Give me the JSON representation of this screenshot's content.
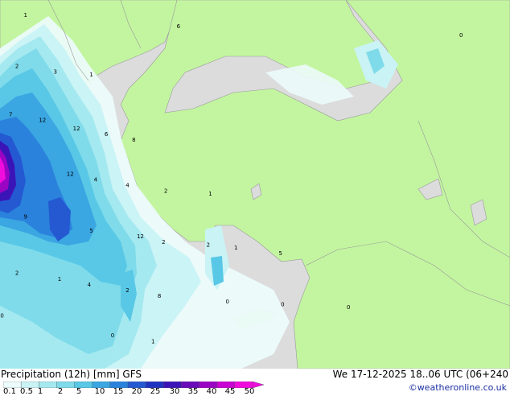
{
  "footer": {
    "title": "Precipitation (12h) [mm] GFS",
    "datetime": "We 17-12-2025 18..06 UTC (06+240",
    "credit": "©weatheronline.co.uk"
  },
  "legend": {
    "labels": [
      "0.1",
      "0.5",
      "1",
      "2",
      "5",
      "10",
      "15",
      "20",
      "25",
      "30",
      "35",
      "40",
      "45",
      "50"
    ],
    "colors": [
      "#ecfbfb",
      "#c9f3f5",
      "#a5e9f0",
      "#7fdbea",
      "#58c8e6",
      "#3aa6e2",
      "#2b82dc",
      "#2459d2",
      "#1f33c1",
      "#3b14b8",
      "#6a0cba",
      "#9a05c4",
      "#c805d2",
      "#f00cdc"
    ]
  },
  "map_labels": [
    {
      "text": "1",
      "lon": 19.2,
      "lat": 41.9
    },
    {
      "text": "6",
      "lon": 26.4,
      "lat": 41.5
    },
    {
      "text": "2",
      "lon": 18.8,
      "lat": 40.1
    },
    {
      "text": "3",
      "lon": 20.6,
      "lat": 39.9
    },
    {
      "text": "1",
      "lon": 22.3,
      "lat": 39.8
    },
    {
      "text": "7",
      "lon": 18.5,
      "lat": 38.4
    },
    {
      "text": "12",
      "lon": 20.0,
      "lat": 38.2
    },
    {
      "text": "12",
      "lon": 21.6,
      "lat": 37.9
    },
    {
      "text": "6",
      "lon": 23.0,
      "lat": 37.7
    },
    {
      "text": "8",
      "lon": 24.3,
      "lat": 37.5
    },
    {
      "text": "12",
      "lon": 21.3,
      "lat": 36.3
    },
    {
      "text": "4",
      "lon": 22.5,
      "lat": 36.1
    },
    {
      "text": "4",
      "lon": 24.0,
      "lat": 35.9
    },
    {
      "text": "2",
      "lon": 25.8,
      "lat": 35.7
    },
    {
      "text": "1",
      "lon": 27.9,
      "lat": 35.6
    },
    {
      "text": "9",
      "lon": 19.2,
      "lat": 34.8
    },
    {
      "text": "5",
      "lon": 22.3,
      "lat": 34.3
    },
    {
      "text": "12",
      "lon": 24.6,
      "lat": 34.1
    },
    {
      "text": "2",
      "lon": 25.7,
      "lat": 33.9
    },
    {
      "text": "2",
      "lon": 27.8,
      "lat": 33.8
    },
    {
      "text": "1",
      "lon": 29.1,
      "lat": 33.7
    },
    {
      "text": "5",
      "lon": 31.2,
      "lat": 33.5
    },
    {
      "text": "2",
      "lon": 18.8,
      "lat": 32.8
    },
    {
      "text": "1",
      "lon": 20.8,
      "lat": 32.6
    },
    {
      "text": "4",
      "lon": 22.2,
      "lat": 32.4
    },
    {
      "text": "2",
      "lon": 24.0,
      "lat": 32.2
    },
    {
      "text": "8",
      "lon": 25.5,
      "lat": 32.0
    },
    {
      "text": "0",
      "lon": 28.7,
      "lat": 31.8
    },
    {
      "text": "0",
      "lon": 31.3,
      "lat": 31.7
    },
    {
      "text": "0",
      "lon": 34.4,
      "lat": 31.6
    },
    {
      "text": "0",
      "lon": 18.1,
      "lat": 31.3
    },
    {
      "text": "0",
      "lon": 23.3,
      "lat": 30.6
    },
    {
      "text": "1",
      "lon": 25.2,
      "lat": 30.4
    },
    {
      "text": "0",
      "lon": 39.7,
      "lat": 41.2
    }
  ]
}
